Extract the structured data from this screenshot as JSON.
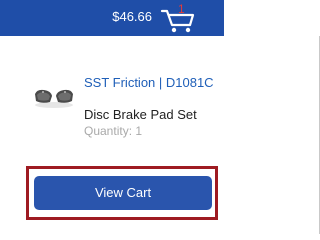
{
  "header": {
    "price": "$46.66",
    "cart_count": "1",
    "cart_icon": "shopping-cart-icon"
  },
  "product": {
    "thumbnail": "brake-pad-image",
    "title": "SST Friction | D1081C",
    "description": "Disc Brake Pad Set",
    "quantity": "Quantity: 1"
  },
  "actions": {
    "view_cart_label": "View Cart"
  },
  "colors": {
    "header_bg": "#1f4ea8",
    "cart_count": "#e23b3b",
    "link": "#1f5fb8",
    "button_bg": "#2a55ad",
    "highlight_border": "#9e1b22"
  }
}
